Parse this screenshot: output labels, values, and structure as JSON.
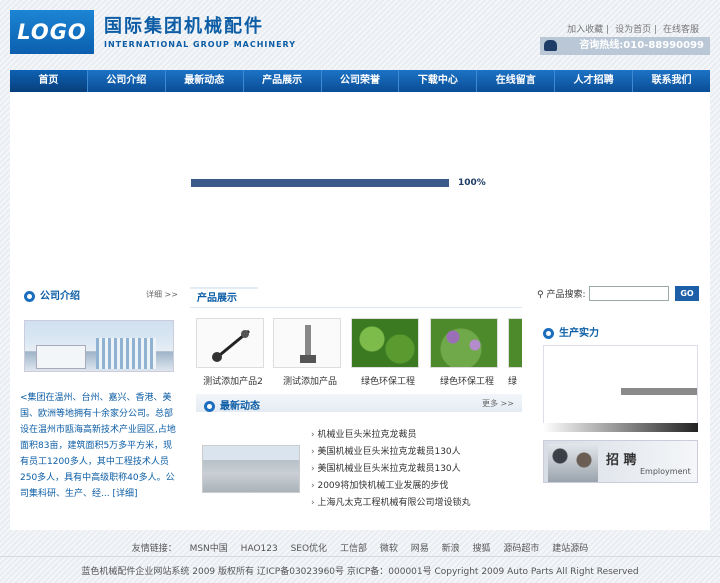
{
  "header": {
    "logo_text": "LOGO",
    "title_cn": "国际集团机械配件",
    "title_en": "INTERNATIONAL GROUP MACHINERY",
    "top_links": [
      "加入收藏",
      "设为首页",
      "在线客服"
    ],
    "hotline": "咨询热线:010-88990099"
  },
  "nav": {
    "items": [
      "首页",
      "公司介绍",
      "最新动态",
      "产品展示",
      "公司荣誉",
      "下载中心",
      "在线留言",
      "人才招聘",
      "联系我们"
    ]
  },
  "banner": {
    "loading_percent": "100%",
    "progress": 1.0
  },
  "company_intro": {
    "title": "公司介绍",
    "more": "详细 >>",
    "text": "<集团在温州、台州、嘉兴、香港、美国、欧洲等地拥有十余家分公司。总部设在温州市瓯海高新技术产业园区,占地面积83亩，建筑面积5万多平方米，现有员工1200多人，其中工程技术人员250多人，具有中高级职称40多人。公司集科研、生产、经... [详细]"
  },
  "products": {
    "title": "产品展示",
    "items": [
      "测试添加产品2",
      "测试添加产品",
      "绿色环保工程",
      "绿色环保工程",
      "绿"
    ]
  },
  "news": {
    "title": "最新动态",
    "more": "更多 >>",
    "items": [
      "机械业巨头米拉克龙裁员",
      "美国机械业巨头米拉克龙裁员130人",
      "美国机械业巨头米拉克龙裁员130人",
      "2009将加快机械工业发展的步伐",
      "上海凡太克工程机械有限公司增设锁丸"
    ]
  },
  "search": {
    "label": "产品搜索:",
    "placeholder": "",
    "button": "GO"
  },
  "capacity": {
    "title": "生产实力"
  },
  "talent": {
    "title": "招 聘",
    "subtitle": "Employment"
  },
  "footer": {
    "links_label": "友情链接：",
    "links": [
      "MSN中国",
      "HAO123",
      "SEO优化",
      "工信部",
      "微软",
      "网易",
      "新浪",
      "搜狐",
      "源码超市",
      "建站源码"
    ],
    "copyright": "蓝色机械配件企业网站系统 2009 版权所有 辽ICP备03023960号 京ICP备：000001号 Copyright 2009 Auto Parts All Right Reserved"
  },
  "colors": {
    "brand_blue": "#0c5da5",
    "nav_blue": "#1d73c6",
    "progress": "#3a5a8a"
  }
}
